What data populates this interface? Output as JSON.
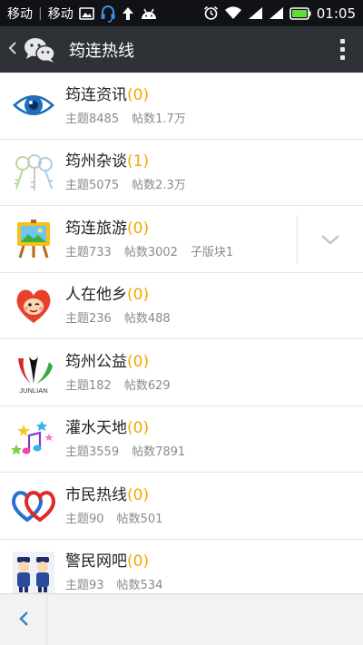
{
  "status_bar": {
    "carrier1": "移动",
    "carrier2": "移动",
    "time": "01:05",
    "icons": [
      "gallery-icon",
      "headset-icon",
      "upload-arrow-icon",
      "android-icon",
      "alarm-icon",
      "wifi-icon",
      "signal-icon",
      "signal-icon",
      "battery-icon"
    ],
    "battery_color": "#5bdc39"
  },
  "header": {
    "title": "筠连热线",
    "icons": [
      "back-arrow-icon",
      "wechat-logo-icon",
      "more-icon"
    ]
  },
  "forums": [
    {
      "name": "筠连资讯",
      "count": "(0)",
      "topics": "主题8485",
      "posts": "帖数1.7万",
      "sub": "",
      "icon": "eye-icon"
    },
    {
      "name": "筠州杂谈",
      "count": "(1)",
      "topics": "主题5075",
      "posts": "帖数2.3万",
      "sub": "",
      "icon": "keys-icon"
    },
    {
      "name": "筠连旅游",
      "count": "(0)",
      "topics": "主题733",
      "posts": "帖数3002",
      "sub": "子版块1",
      "icon": "easel-icon"
    },
    {
      "name": "人在他乡",
      "count": "(0)",
      "topics": "主题236",
      "posts": "帖数488",
      "sub": "",
      "icon": "heart-face-icon"
    },
    {
      "name": "筠州公益",
      "count": "(0)",
      "topics": "主题182",
      "posts": "帖数629",
      "sub": "",
      "icon": "junlian-logo-icon"
    },
    {
      "name": "灌水天地",
      "count": "(0)",
      "topics": "主题3559",
      "posts": "帖数7891",
      "sub": "",
      "icon": "music-stars-icon"
    },
    {
      "name": "市民热线",
      "count": "(0)",
      "topics": "主题90",
      "posts": "帖数501",
      "sub": "",
      "icon": "hearts-icon"
    },
    {
      "name": "警民网吧",
      "count": "(0)",
      "topics": "主题93",
      "posts": "帖数534",
      "sub": "",
      "icon": "police-icon"
    }
  ],
  "logo_text": "JUNLIAN",
  "colors": {
    "count": "#f0a800",
    "header_bg": "#2e3237",
    "status_bg": "#101215"
  }
}
